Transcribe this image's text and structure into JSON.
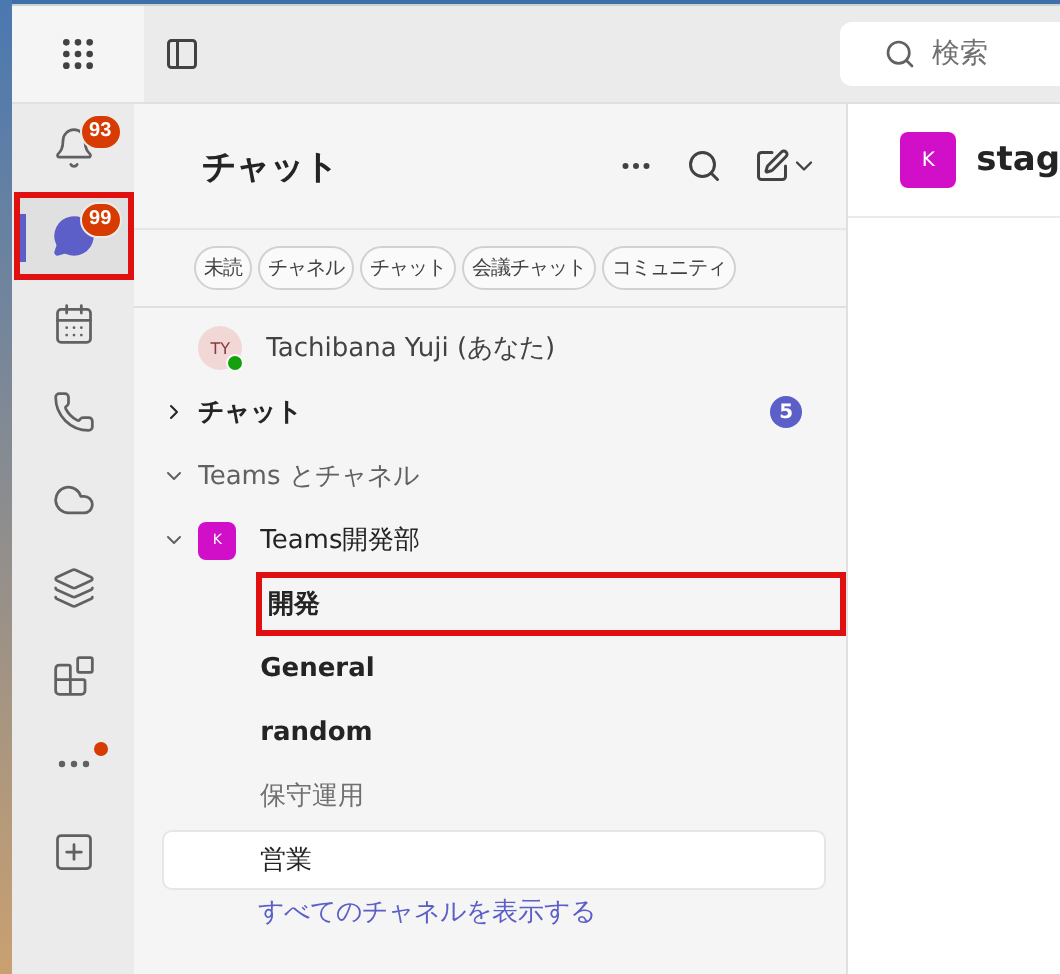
{
  "top_bar": {
    "search": {
      "placeholder": "検索"
    }
  },
  "rail": [
    {
      "kind": "bell",
      "badge": "93",
      "selected": false,
      "highlighted": false,
      "dot": false
    },
    {
      "kind": "chat",
      "badge": "99",
      "selected": true,
      "highlighted": true,
      "dot": false
    },
    {
      "kind": "calendar",
      "selected": false,
      "highlighted": false,
      "dot": false
    },
    {
      "kind": "call",
      "selected": false,
      "highlighted": false,
      "dot": false
    },
    {
      "kind": "cloud",
      "selected": false,
      "highlighted": false,
      "dot": false
    },
    {
      "kind": "copilot",
      "selected": false,
      "highlighted": false,
      "dot": false
    },
    {
      "kind": "apps",
      "selected": false,
      "highlighted": false,
      "dot": false
    },
    {
      "kind": "more",
      "selected": false,
      "highlighted": false,
      "dot": true
    },
    {
      "kind": "add",
      "selected": false,
      "highlighted": false,
      "dot": false
    }
  ],
  "chat_panel": {
    "title": "チャット",
    "filters": [
      {
        "label": "未読",
        "selected": false
      },
      {
        "label": "チャネル",
        "selected": false
      },
      {
        "label": "チャット",
        "selected": false
      },
      {
        "label": "会議チャット",
        "selected": false
      },
      {
        "label": "コミュニティ",
        "selected": false
      }
    ],
    "me": {
      "initials": "TY",
      "name": "Tachibana Yuji (あなた)"
    },
    "chat_section": {
      "label": "チャット",
      "expanded": false,
      "count": "5"
    },
    "teams_section": {
      "label": "Teams とチャネル",
      "expanded": true
    },
    "team": {
      "avatar": "K",
      "name": "Teams開発部",
      "expanded": true,
      "channels": [
        {
          "name": "開発",
          "unread": true,
          "selected": false,
          "highlighted": true,
          "muted": false
        },
        {
          "name": "General",
          "unread": true,
          "selected": false,
          "highlighted": false,
          "muted": false
        },
        {
          "name": "random",
          "unread": true,
          "selected": false,
          "highlighted": false,
          "muted": false
        },
        {
          "name": "保守運用",
          "unread": false,
          "selected": false,
          "highlighted": false,
          "muted": true
        },
        {
          "name": "営業",
          "unread": false,
          "selected": true,
          "highlighted": false,
          "muted": false
        }
      ],
      "show_all": "すべてのチャネルを表示する"
    }
  },
  "conversation": {
    "avatar": "K",
    "title": "stag"
  }
}
